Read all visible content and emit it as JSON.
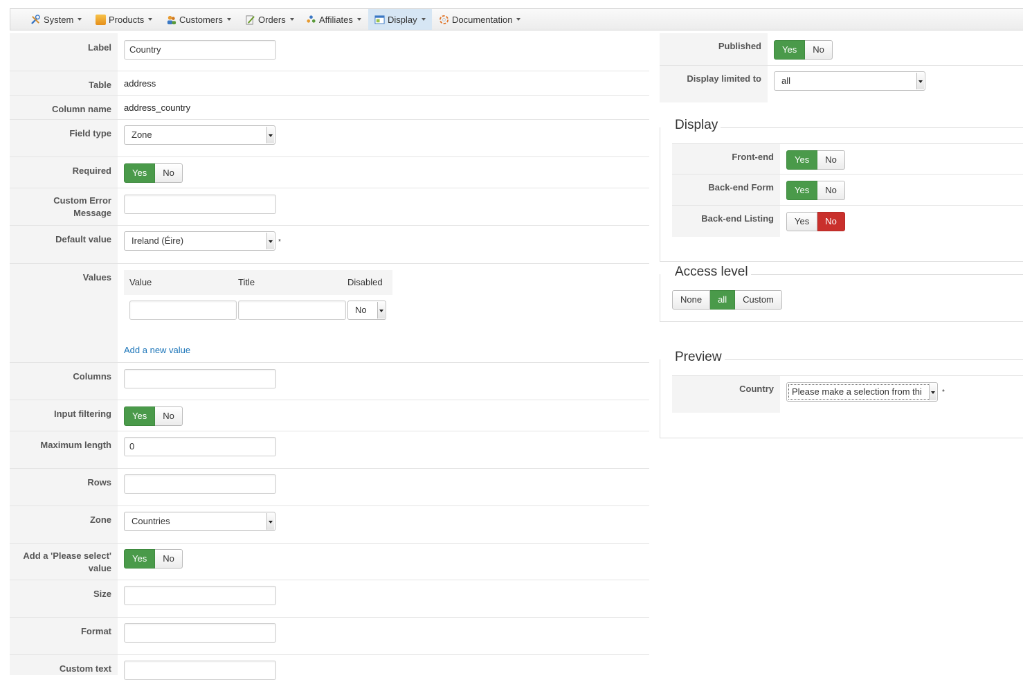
{
  "menu": {
    "system": "System",
    "products": "Products",
    "customers": "Customers",
    "orders": "Orders",
    "affiliates": "Affiliates",
    "display": "Display",
    "documentation": "Documentation"
  },
  "form": {
    "label": {
      "label": "Label",
      "value": "Country"
    },
    "table": {
      "label": "Table",
      "value": "address"
    },
    "column_name": {
      "label": "Column name",
      "value": "address_country"
    },
    "field_type": {
      "label": "Field type",
      "value": "Zone"
    },
    "required": {
      "label": "Required",
      "yes": "Yes",
      "no": "No",
      "selected": "Yes"
    },
    "custom_error": {
      "label1": "Custom Error",
      "label2": "Message",
      "value": ""
    },
    "default_value": {
      "label": "Default value",
      "value": "Ireland (Éire)",
      "required_mark": "*"
    },
    "values": {
      "label": "Values",
      "col_value": "Value",
      "col_title": "Title",
      "col_disabled": "Disabled",
      "row_disabled": "No",
      "add_link": "Add a new value"
    },
    "columns": {
      "label": "Columns",
      "value": ""
    },
    "input_filtering": {
      "label": "Input filtering",
      "yes": "Yes",
      "no": "No",
      "selected": "Yes"
    },
    "maximum_length": {
      "label": "Maximum length",
      "value": "0"
    },
    "rows": {
      "label": "Rows",
      "value": ""
    },
    "zone": {
      "label": "Zone",
      "value": "Countries"
    },
    "please_select": {
      "label1": "Add a 'Please select'",
      "label2": "value",
      "yes": "Yes",
      "no": "No",
      "selected": "Yes"
    },
    "size": {
      "label": "Size",
      "value": ""
    },
    "format": {
      "label": "Format",
      "value": ""
    },
    "custom_text": {
      "label": "Custom text",
      "value": ""
    }
  },
  "side": {
    "published": {
      "label": "Published",
      "yes": "Yes",
      "no": "No",
      "selected": "Yes"
    },
    "display_limited": {
      "label": "Display limited to",
      "value": "all"
    },
    "display_section": {
      "title": "Display",
      "front_end": {
        "label": "Front-end",
        "yes": "Yes",
        "no": "No",
        "selected": "Yes"
      },
      "backend_form": {
        "label": "Back-end Form",
        "yes": "Yes",
        "no": "No",
        "selected": "Yes"
      },
      "backend_listing": {
        "label": "Back-end Listing",
        "yes": "Yes",
        "no": "No",
        "selected": "No"
      }
    },
    "access_level": {
      "title": "Access level",
      "none": "None",
      "all": "all",
      "custom": "Custom",
      "selected": "all"
    },
    "preview": {
      "title": "Preview",
      "label": "Country",
      "value": "Please make a selection from thi",
      "required_mark": "*"
    }
  },
  "colors": {
    "green": "#4a9a4a",
    "red": "#c9302c",
    "link": "#1a74b8",
    "menu_active": "#d6e6f4"
  }
}
